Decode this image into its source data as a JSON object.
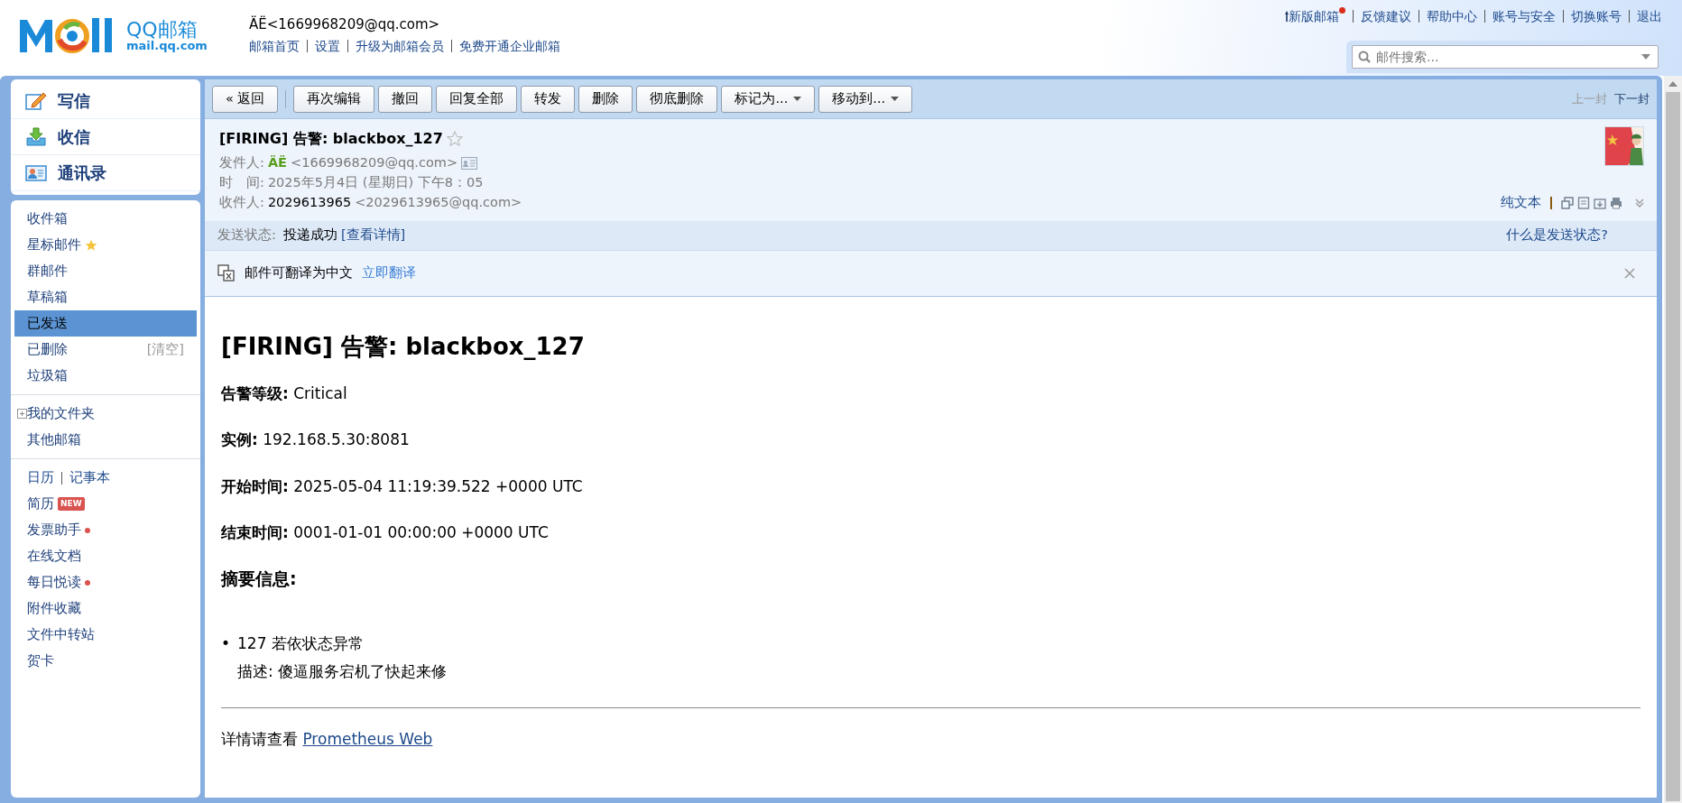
{
  "header": {
    "logo_title": "QQ邮箱",
    "logo_sub": "mail.qq.com",
    "account": "ÄË<1669968209@qq.com>",
    "account_links": [
      "邮箱首页",
      "设置",
      "升级为邮箱会员",
      "免费开通企业邮箱"
    ],
    "top_links": [
      {
        "label": "新版邮箱",
        "kind": "new"
      },
      {
        "label": "反馈建议",
        "kind": "plain"
      },
      {
        "label": "帮助中心",
        "kind": "plain"
      },
      {
        "label": "账号与安全",
        "kind": "plain"
      },
      {
        "label": "切换账号",
        "kind": "plain"
      },
      {
        "label": "退出",
        "kind": "plain"
      }
    ],
    "search": {
      "placeholder": "邮件搜索..."
    }
  },
  "sidebar": {
    "actions": [
      {
        "label": "写信",
        "kind": "compose"
      },
      {
        "label": "收信",
        "kind": "inbox"
      },
      {
        "label": "通讯录",
        "kind": "contacts"
      }
    ],
    "groups": [
      [
        {
          "label": "收件箱",
          "kind": "plain",
          "selected": false
        },
        {
          "label": "星标邮件",
          "kind": "star",
          "selected": false
        },
        {
          "label": "群邮件",
          "kind": "plain",
          "selected": false
        },
        {
          "label": "草稿箱",
          "kind": "plain",
          "selected": false
        },
        {
          "label": "已发送",
          "kind": "plain",
          "selected": true
        },
        {
          "label": "已删除",
          "kind": "extra",
          "extra": "[清空]",
          "selected": false
        },
        {
          "label": "垃圾箱",
          "kind": "plain",
          "selected": false
        }
      ],
      [
        {
          "label": "我的文件夹",
          "kind": "expander",
          "expanded": false,
          "selected": false
        },
        {
          "label": "其他邮箱",
          "kind": "plain",
          "selected": false
        }
      ],
      [
        {
          "label": "日历",
          "kind": "pair",
          "extra": "记事本",
          "selected": false
        },
        {
          "label": "简历",
          "kind": "badge",
          "badge": "NEW",
          "selected": false
        },
        {
          "label": "发票助手",
          "kind": "dot",
          "selected": false
        },
        {
          "label": "在线文档",
          "kind": "plain",
          "selected": false
        },
        {
          "label": "每日悦读",
          "kind": "dot",
          "selected": false
        },
        {
          "label": "附件收藏",
          "kind": "plain",
          "selected": false
        },
        {
          "label": "文件中转站",
          "kind": "plain",
          "selected": false
        },
        {
          "label": "贺卡",
          "kind": "plain",
          "selected": false
        }
      ]
    ]
  },
  "toolbar": {
    "buttons": [
      {
        "label": "« 返回",
        "kind": "button"
      },
      {
        "label": "再次编辑",
        "kind": "button"
      },
      {
        "label": "撤回",
        "kind": "button"
      },
      {
        "label": "回复全部",
        "kind": "button"
      },
      {
        "label": "转发",
        "kind": "button"
      },
      {
        "label": "删除",
        "kind": "button"
      },
      {
        "label": "彻底删除",
        "kind": "button"
      },
      {
        "label": "标记为...",
        "kind": "dropdown"
      },
      {
        "label": "移动到...",
        "kind": "dropdown"
      }
    ],
    "nav": [
      {
        "label": "上一封",
        "disabled": true
      },
      {
        "label": "下一封",
        "disabled": false
      }
    ]
  },
  "mail": {
    "subject": "[FIRING] 告警: blackbox_127",
    "starred": false,
    "from_label": "发件人:",
    "from_name": "ÄË",
    "from_email": "<1669968209@qq.com>",
    "time_label": "时　间:",
    "time": "2025年5月4日 (星期日) 下午8：05",
    "to_label": "收件人:",
    "to_name": "2029613965",
    "to_email": "<2029613965@qq.com>",
    "view_link": "纯文本",
    "status": {
      "label": "发送状态:",
      "value": "投递成功",
      "link": "[查看详情]",
      "help": "什么是发送状态?"
    },
    "translate": {
      "text": "邮件可翻译为中文",
      "link": "立即翻译"
    }
  },
  "body": {
    "heading": "[FIRING] 告警: blackbox_127",
    "fields": [
      {
        "label": "告警等级:",
        "value": "Critical"
      },
      {
        "label": "实例:",
        "value": "192.168.5.30:8081"
      },
      {
        "label": "开始时间:",
        "value": "2025-05-04 11:19:39.522 +0000 UTC"
      },
      {
        "label": "结束时间:",
        "value": "0001-01-01 00:00:00 +0000 UTC"
      }
    ],
    "summary_heading": "摘要信息:",
    "items": [
      {
        "marker": "•",
        "title": "127 若依状态异常",
        "desc": "描述: 傻逼服务宕机了快起来修"
      }
    ],
    "footer_text": "详情请查看",
    "footer_link": "Prometheus Web"
  }
}
